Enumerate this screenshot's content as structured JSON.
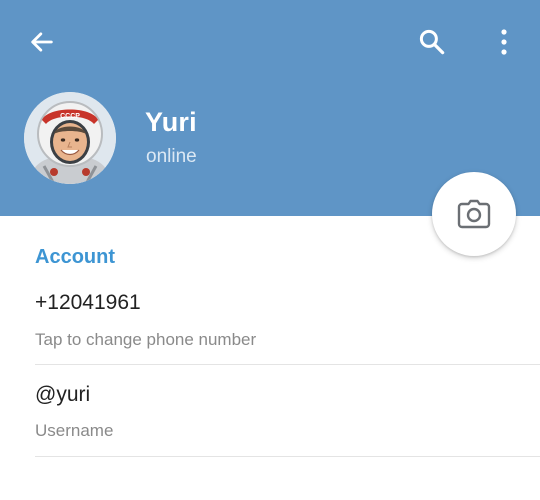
{
  "header": {
    "background_color": "#5f95c6",
    "back_icon": "arrow-left-icon",
    "search_icon": "search-icon",
    "more_icon": "more-vertical-icon"
  },
  "profile": {
    "name": "Yuri",
    "status": "online",
    "camera_icon": "camera-icon"
  },
  "account": {
    "section_title": "Account",
    "accent_color": "#3d95d3",
    "phone": {
      "value": "+12041961",
      "caption": "Tap to change phone number"
    },
    "username": {
      "value": "@yuri",
      "caption": "Username"
    }
  }
}
